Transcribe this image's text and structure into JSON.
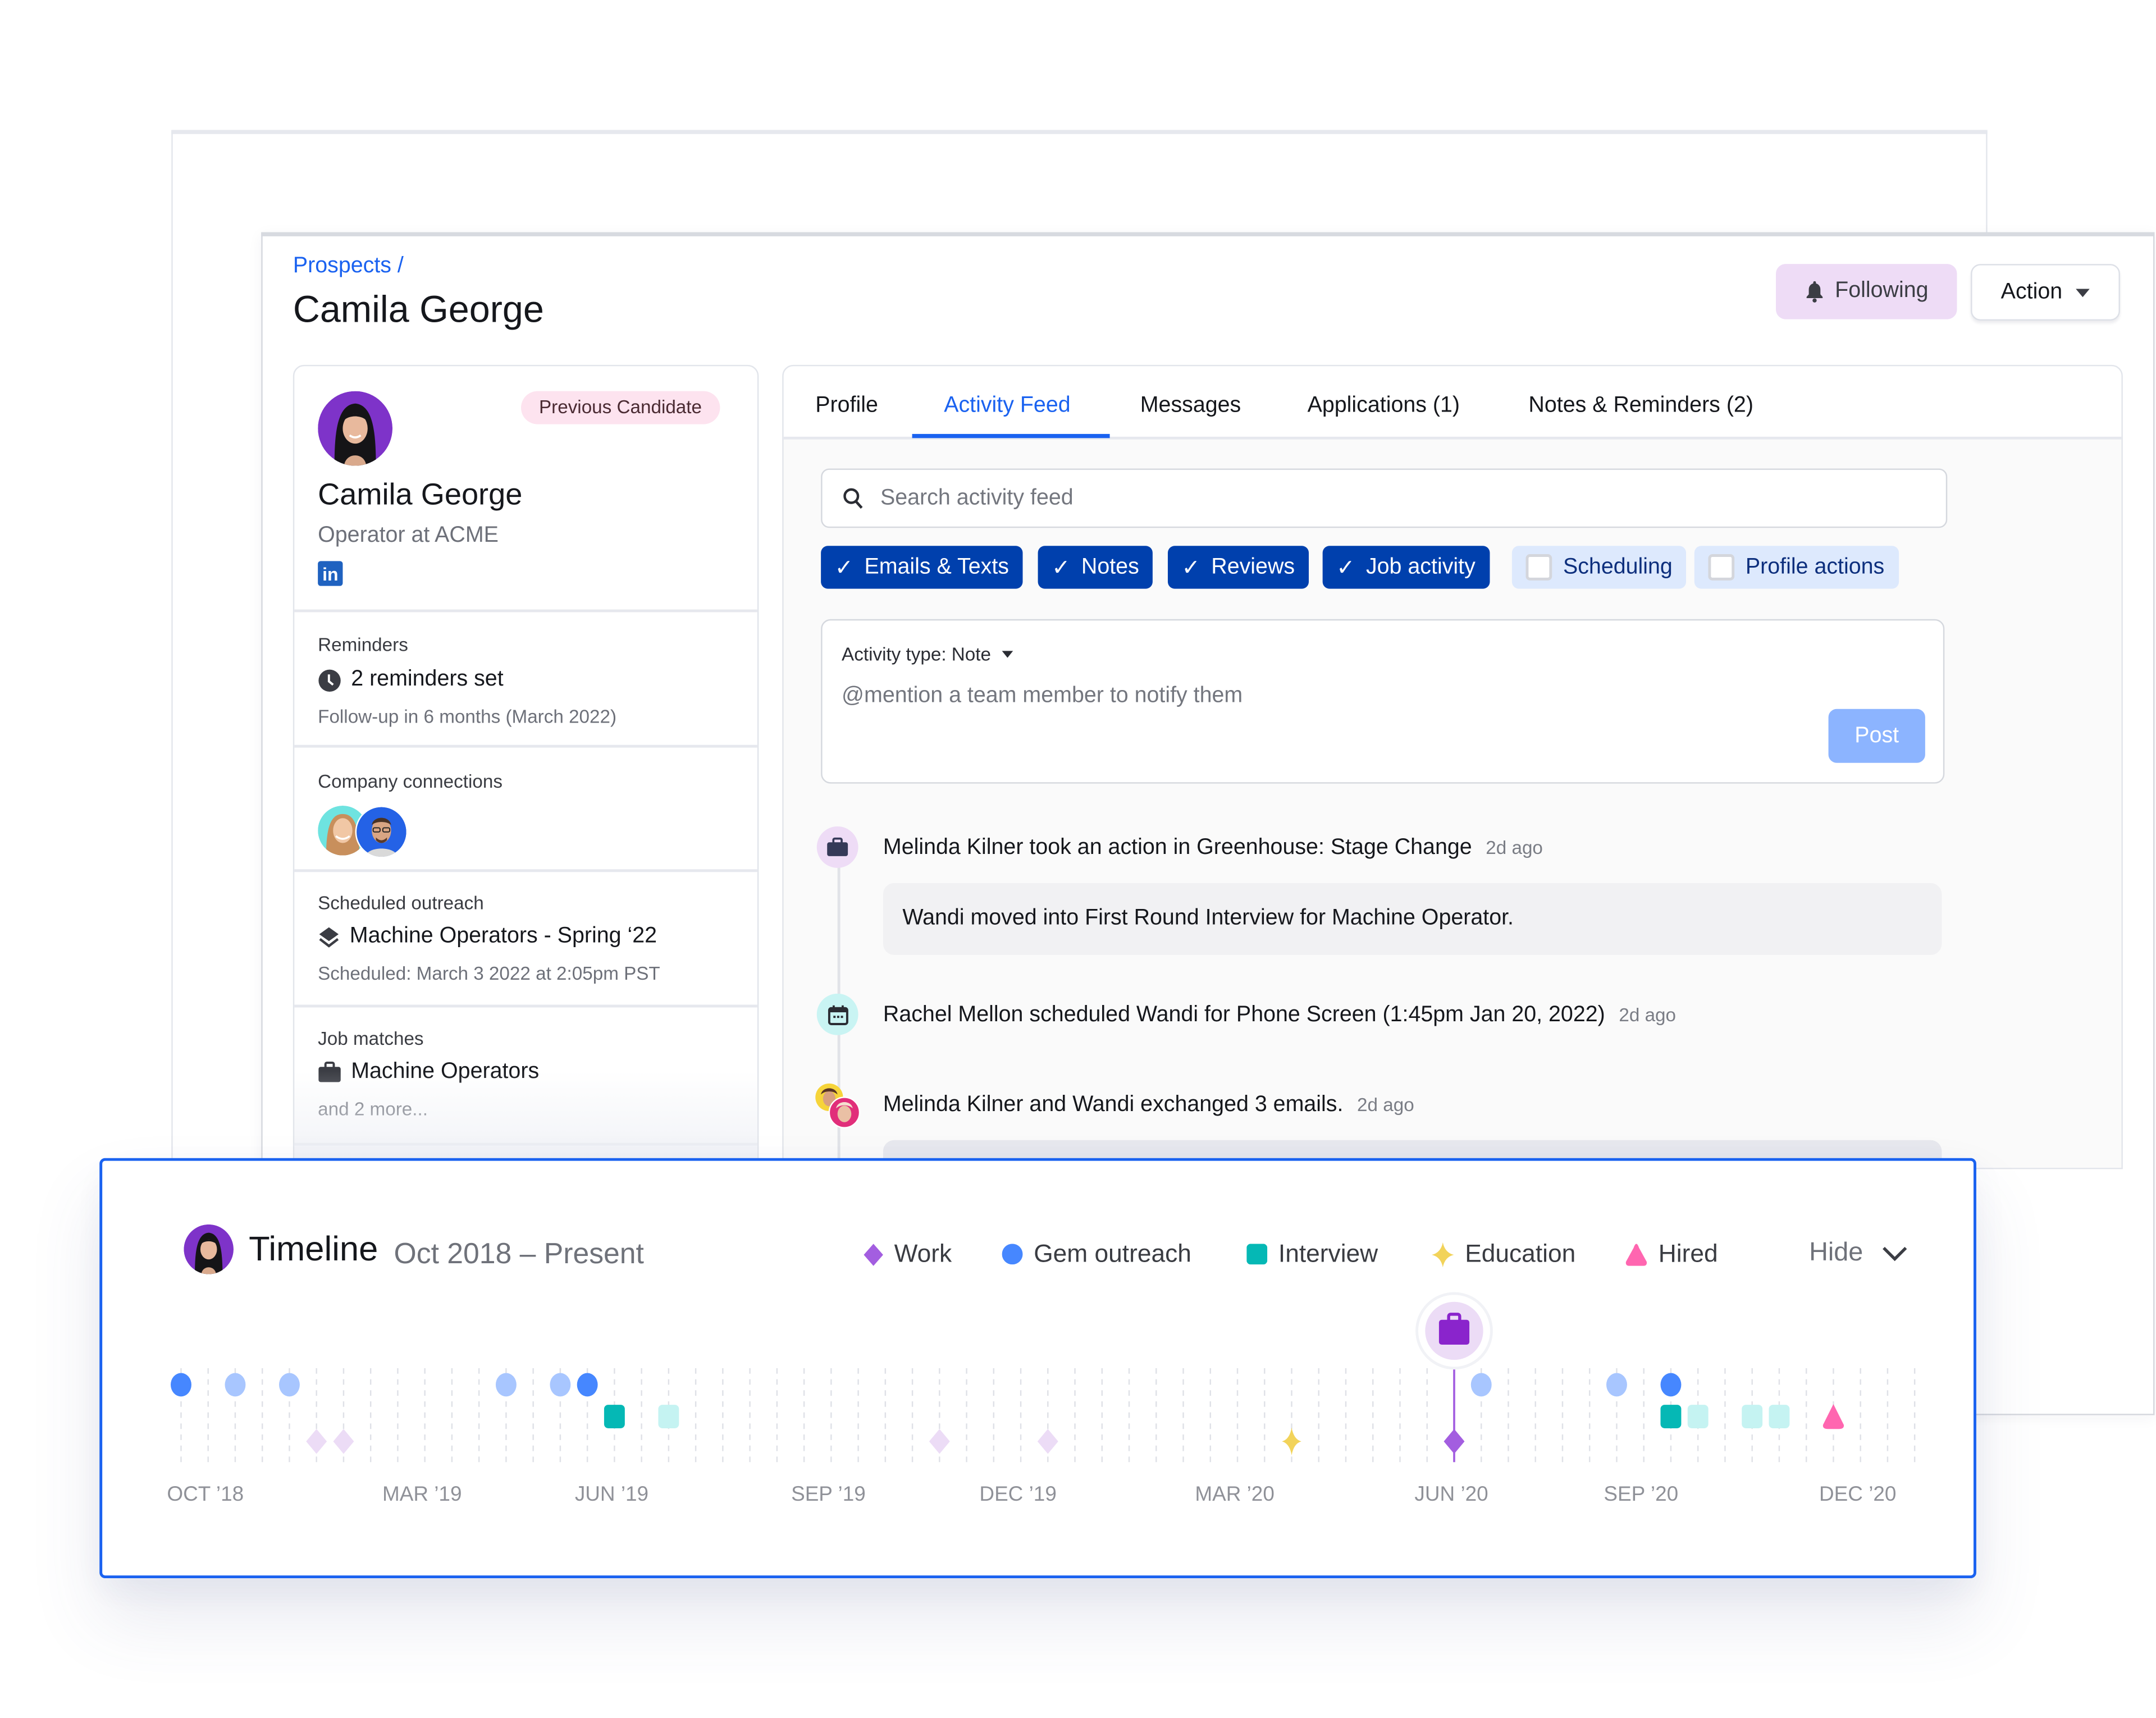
{
  "header": {
    "breadcrumb": "Prospects /",
    "title": "Camila George",
    "following_label": "Following",
    "action_label": "Action"
  },
  "profile": {
    "badge": "Previous Candidate",
    "name": "Camila George",
    "subtitle": "Operator at ACME",
    "linkedin_glyph": "in",
    "sections": [
      {
        "label": "Reminders",
        "main": "2 reminders set",
        "icon": "clock-icon",
        "sub": "Follow-up in 6 months (March 2022)"
      },
      {
        "label": "Company connections"
      },
      {
        "label": "Scheduled outreach",
        "main": "Machine Operators - Spring ‘22",
        "icon": "layers-icon",
        "sub": "Scheduled: March 3 2022 at 2:05pm PST"
      },
      {
        "label": "Job matches",
        "main": "Machine Operators",
        "icon": "briefcase-icon",
        "sub": "and 2 more..."
      }
    ]
  },
  "tabs": [
    {
      "label": "Profile",
      "active": false
    },
    {
      "label": "Activity Feed",
      "active": true
    },
    {
      "label": "Messages",
      "active": false
    },
    {
      "label": "Applications (1)",
      "active": false
    },
    {
      "label": "Notes & Reminders (2)",
      "active": false
    }
  ],
  "feed": {
    "search_placeholder": "Search activity feed",
    "filters": [
      {
        "label": "Emails & Texts",
        "checked": true
      },
      {
        "label": "Notes",
        "checked": true
      },
      {
        "label": "Reviews",
        "checked": true
      },
      {
        "label": "Job activity",
        "checked": true
      },
      {
        "label": "Scheduling",
        "checked": false
      },
      {
        "label": "Profile actions",
        "checked": false
      }
    ],
    "composer": {
      "activity_type": "Activity type: Note",
      "placeholder": "@mention a team member to notify them",
      "post_label": "Post"
    },
    "items": [
      {
        "actor": "Melinda Kilner",
        "text": " took an action in Greenhouse: Stage Change",
        "ago": "2d ago",
        "detail_pre": "Wandi moved into First Round Interview for ",
        "detail_bold": "Machine Operator."
      },
      {
        "actor": "Rachel Mellon",
        "text": " scheduled Wandi for ",
        "bold": "Phone Screen (1:45pm Jan 20, 2022)",
        "ago": "2d ago"
      },
      {
        "actor": "Melinda Kilner",
        "text": " and Wandi exchanged 3 emails.",
        "ago": "2d ago"
      }
    ]
  },
  "timeline": {
    "title": "Timeline",
    "range": "Oct 2018 – Present",
    "hide_label": "Hide",
    "legend": [
      {
        "label": "Work",
        "shape": "diamond",
        "color": "#a35ee0"
      },
      {
        "label": "Gem outreach",
        "shape": "circle",
        "color": "#4687ff"
      },
      {
        "label": "Interview",
        "shape": "square",
        "color": "#05b8b5"
      },
      {
        "label": "Education",
        "shape": "star",
        "color": "#f2d35a"
      },
      {
        "label": "Hired",
        "shape": "triangle",
        "color": "#ff66b0"
      }
    ]
  },
  "chart_data": {
    "type": "scatter",
    "title": "Timeline",
    "subtitle": "Oct 2018 – Present",
    "x_unit": "weeks since Oct 1 2018 (approx., 1 grid column ≈ 2 weeks)",
    "x_range": [
      0,
      64
    ],
    "tick_labels": [
      {
        "label": "OCT ’18",
        "x": 1
      },
      {
        "label": "MAR ’19",
        "x": 9
      },
      {
        "label": "JUN ’19",
        "x": 16
      },
      {
        "label": "SEP ’19",
        "x": 24
      },
      {
        "label": "DEC ’19",
        "x": 31
      },
      {
        "label": "MAR ’20",
        "x": 39
      },
      {
        "label": "JUN ’20",
        "x": 47
      },
      {
        "label": "SEP ’20",
        "x": 54
      },
      {
        "label": "DEC ’20",
        "x": 62
      }
    ],
    "grid": true,
    "legend_position": "top-right",
    "series": [
      {
        "name": "Gem outreach",
        "row": 0,
        "points": [
          {
            "x": 0,
            "emphasis": true
          },
          {
            "x": 2,
            "emphasis": false
          },
          {
            "x": 4,
            "emphasis": false
          },
          {
            "x": 12,
            "emphasis": false
          },
          {
            "x": 14,
            "emphasis": false
          },
          {
            "x": 15,
            "emphasis": true
          },
          {
            "x": 48,
            "emphasis": false
          },
          {
            "x": 53,
            "emphasis": false
          },
          {
            "x": 55,
            "emphasis": true
          }
        ]
      },
      {
        "name": "Interview",
        "row": 1,
        "points": [
          {
            "x": 16,
            "emphasis": true
          },
          {
            "x": 18,
            "emphasis": false
          },
          {
            "x": 55,
            "emphasis": true
          },
          {
            "x": 56,
            "emphasis": false
          },
          {
            "x": 58,
            "emphasis": false
          },
          {
            "x": 59,
            "emphasis": false
          }
        ]
      },
      {
        "name": "Hired",
        "row": 1,
        "points": [
          {
            "x": 61,
            "emphasis": true
          }
        ]
      },
      {
        "name": "Work",
        "row": 2,
        "points": [
          {
            "x": 5,
            "emphasis": false
          },
          {
            "x": 6,
            "emphasis": false
          },
          {
            "x": 28,
            "emphasis": false
          },
          {
            "x": 32,
            "emphasis": false
          },
          {
            "x": 47,
            "emphasis": true,
            "highlighted": true
          }
        ]
      },
      {
        "name": "Education",
        "row": 2,
        "points": [
          {
            "x": 41,
            "emphasis": true
          }
        ]
      }
    ],
    "highlight_marker": {
      "x": 47,
      "icon": "briefcase-icon",
      "series": "Work"
    }
  }
}
